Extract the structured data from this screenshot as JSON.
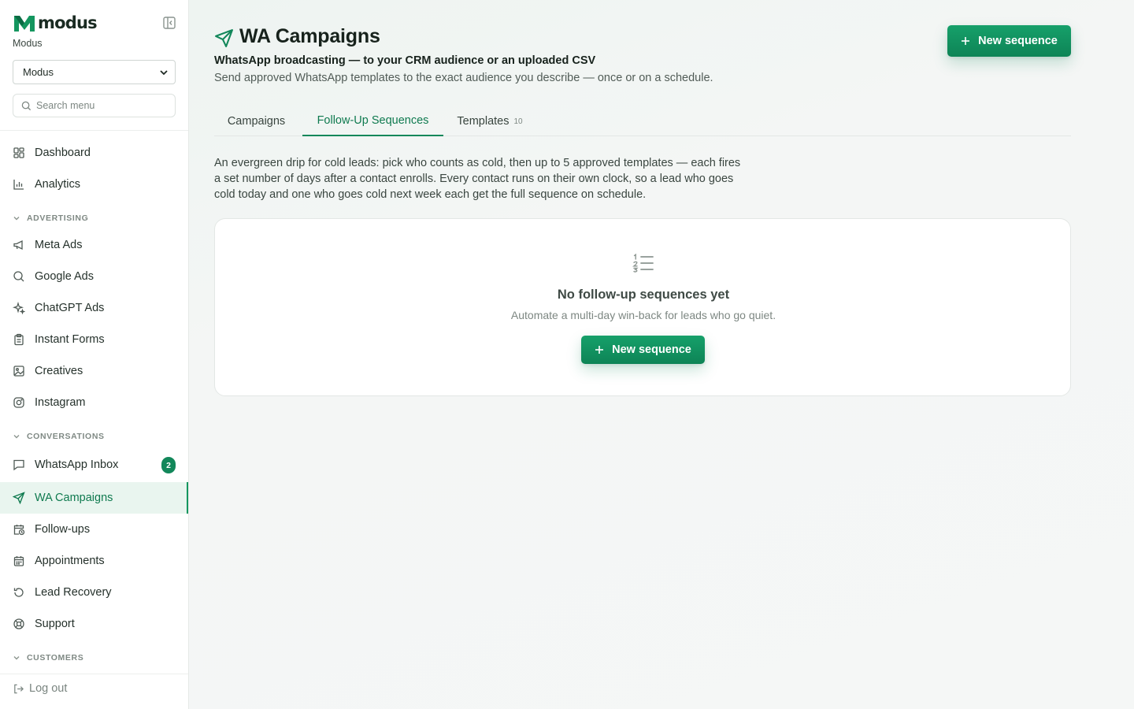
{
  "brand": {
    "name": "modus",
    "org_label": "Modus",
    "org_selected": "Modus"
  },
  "search": {
    "placeholder": "Search menu"
  },
  "nav": {
    "dashboard": "Dashboard",
    "analytics": "Analytics",
    "advertising_header": "ADVERTISING",
    "meta_ads": "Meta Ads",
    "google_ads": "Google Ads",
    "chatgpt_ads": "ChatGPT Ads",
    "instant_forms": "Instant Forms",
    "creatives": "Creatives",
    "instagram": "Instagram",
    "conversations_header": "CONVERSATIONS",
    "whatsapp_inbox": "WhatsApp Inbox",
    "whatsapp_inbox_badge": "2",
    "wa_campaigns": "WA Campaigns",
    "follow_ups": "Follow-ups",
    "appointments": "Appointments",
    "lead_recovery": "Lead Recovery",
    "support": "Support",
    "customers_header": "CUSTOMERS",
    "logout": "Log out"
  },
  "page": {
    "title": "WA Campaigns",
    "subtitle": "WhatsApp broadcasting — to your CRM audience or an uploaded CSV",
    "description": "Send approved WhatsApp templates to the exact audience you describe — once or on a schedule.",
    "new_button": "New sequence"
  },
  "tabs": {
    "campaigns": "Campaigns",
    "sequences": "Follow-Up Sequences",
    "templates": "Templates",
    "templates_count": "10",
    "active": "Follow-Up Sequences"
  },
  "intro": "An evergreen drip for cold leads: pick who counts as cold, then up to 5 approved templates — each fires a set number of days after a contact enrolls. Every contact runs on their own clock, so a lead who goes cold today and one who goes cold next week each get the full sequence on schedule.",
  "empty_state": {
    "title": "No follow-up sequences yet",
    "description": "Automate a multi-day win-back for leads who go quiet.",
    "button": "New sequence"
  },
  "colors": {
    "accent": "#12875a",
    "active_bg": "#e9f5ef",
    "text": "#1f2a24"
  },
  "icons": {
    "logo": "modus-m-logo",
    "collapse": "sidebar-collapse-icon",
    "search": "search-icon",
    "page": "send-icon",
    "plus": "plus-icon",
    "empty": "numbered-list-icon"
  }
}
